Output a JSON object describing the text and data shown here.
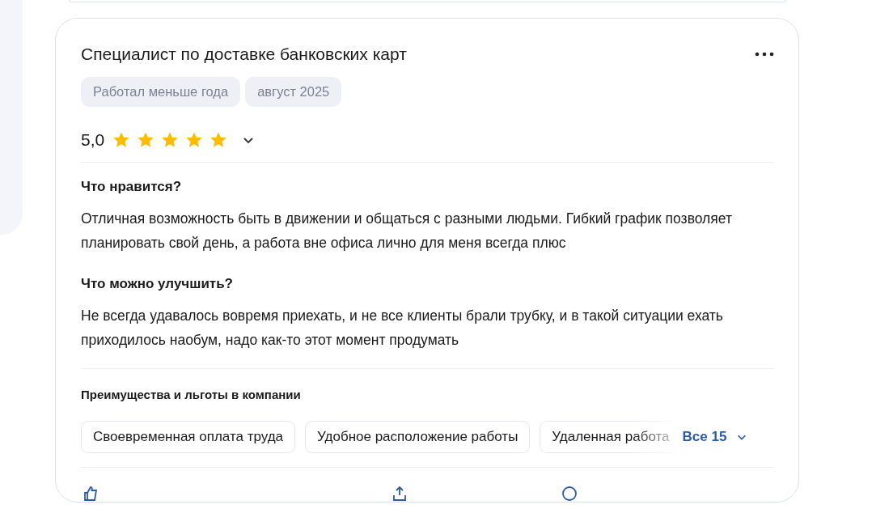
{
  "review": {
    "title": "Специалист по доставке банковских карт",
    "tags": [
      "Работал меньше года",
      "август 2025"
    ],
    "rating": {
      "value": "5,0",
      "stars": 5
    },
    "sections": [
      {
        "heading": "Что нравится?",
        "text": "Отличная возможность быть в движении и общаться с разными людьми. Гибкий график позволяет планировать свой день, а работа вне офиса лично для меня всегда плюс"
      },
      {
        "heading": "Что можно улучшить?",
        "text": "Не всегда удавалось вовремя приехать, и не все клиенты брали трубку, и в такой ситуации ехать приходилось наобум, надо как-то этот момент продумать"
      }
    ],
    "benefits": {
      "title": "Преимущества и льготы в компании",
      "items": [
        "Своевременная оплата труда",
        "Удобное расположение работы",
        "Удаленная работа"
      ],
      "more": "Все 15"
    }
  }
}
